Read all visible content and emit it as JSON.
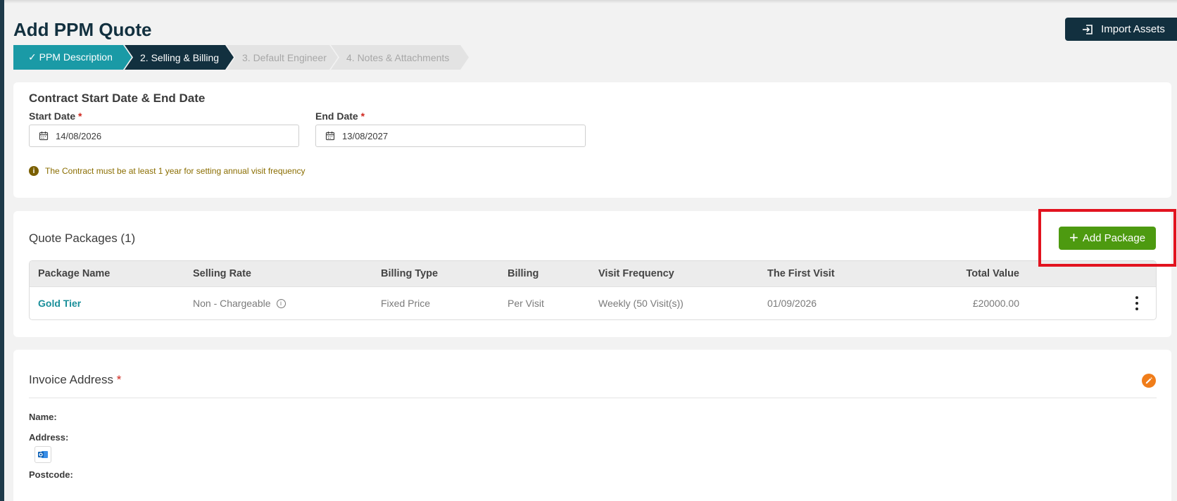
{
  "page": {
    "title": "Add PPM Quote"
  },
  "toolbar": {
    "import_label": "Import Assets"
  },
  "stepper": {
    "steps": [
      {
        "label": "✓ PPM Description",
        "state": "done"
      },
      {
        "label": "2. Selling & Billing",
        "state": "active"
      },
      {
        "label": "3. Default Engineer",
        "state": "pending"
      },
      {
        "label": "4. Notes & Attachments",
        "state": "pending"
      }
    ]
  },
  "contract": {
    "title": "Contract Start Date & End Date",
    "start_label": "Start Date",
    "start_value": "14/08/2026",
    "end_label": "End Date",
    "end_value": "13/08/2027",
    "required_mark": "*",
    "notice": "The Contract must be at least 1 year for setting annual visit frequency",
    "notice_icon": "i"
  },
  "packages": {
    "title": "Quote Packages (1)",
    "add_label": "Add Package",
    "add_icon": "+",
    "columns": [
      "Package Name",
      "Selling Rate",
      "Billing Type",
      "Billing",
      "Visit Frequency",
      "The First Visit",
      "Total Value"
    ],
    "rows": [
      {
        "package_name": "Gold Tier",
        "selling_rate": "Non - Chargeable",
        "billing_type": "Fixed Price",
        "billing": "Per Visit",
        "visit_frequency": "Weekly (50 Visit(s))",
        "first_visit": "01/09/2026",
        "total_value": "£20000.00"
      }
    ]
  },
  "invoice": {
    "title": "Invoice Address",
    "required_mark": "*",
    "name_label": "Name:",
    "address_label": "Address:",
    "postcode_label": "Postcode:"
  },
  "colors": {
    "brand_dark": "#12303f",
    "step_done": "#1a9aa6",
    "add_button": "#4d9a10",
    "link": "#1a8f9a",
    "highlight": "#e2131f",
    "edit": "#f07d1a"
  }
}
